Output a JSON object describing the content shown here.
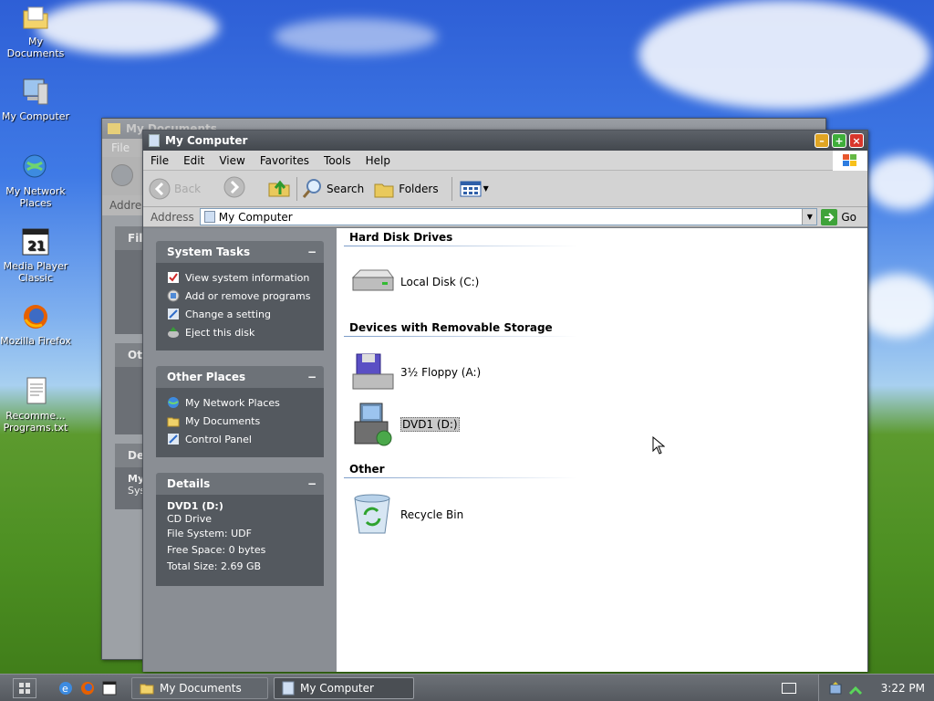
{
  "desktop": {
    "icons": [
      {
        "label": "My Documents"
      },
      {
        "label": "My Computer"
      },
      {
        "label": "My Network Places"
      },
      {
        "label": "Media Player Classic"
      },
      {
        "label": "Mozilla Firefox"
      },
      {
        "label": "Recomme... Programs.txt"
      }
    ]
  },
  "bg_window": {
    "title": "My Documents",
    "menu_first": "File",
    "addr_label": "Addre",
    "panel_heads": [
      "Fil",
      "Ot",
      "De"
    ],
    "details_title": "My",
    "details_sub": "Sys"
  },
  "window": {
    "title": "My Computer",
    "menu": [
      "File",
      "Edit",
      "View",
      "Favorites",
      "Tools",
      "Help"
    ],
    "toolbar": {
      "back": "Back",
      "search": "Search",
      "folders": "Folders"
    },
    "address": {
      "label": "Address",
      "value": "My Computer",
      "go": "Go"
    }
  },
  "left_pane": {
    "system_tasks": {
      "title": "System Tasks",
      "collapse": "−",
      "items": [
        "View system information",
        "Add or remove programs",
        "Change a setting",
        "Eject this disk"
      ]
    },
    "other_places": {
      "title": "Other Places",
      "collapse": "−",
      "items": [
        "My Network Places",
        "My Documents",
        "Control Panel"
      ]
    },
    "details": {
      "title": "Details",
      "collapse": "−",
      "name": "DVD1 (D:)",
      "type": "CD Drive",
      "file_system": "File System: UDF",
      "free_space": "Free Space: 0 bytes",
      "total_size": "Total Size: 2.69 GB"
    }
  },
  "content": {
    "groups": [
      {
        "title": "Hard Disk Drives",
        "items": [
          "Local Disk (C:)"
        ]
      },
      {
        "title": "Devices with Removable Storage",
        "items": [
          "3½ Floppy (A:)",
          "DVD1 (D:)"
        ]
      },
      {
        "title": "Other",
        "items": [
          "Recycle Bin"
        ]
      }
    ],
    "selected": "DVD1 (D:)"
  },
  "taskbar": {
    "tasks": [
      "My Documents",
      "My Computer"
    ],
    "clock": "3:22 PM"
  },
  "colors": {
    "selection": "#c9c9c9",
    "title_bar": "#4b5056",
    "panel_body": "#54595f"
  }
}
